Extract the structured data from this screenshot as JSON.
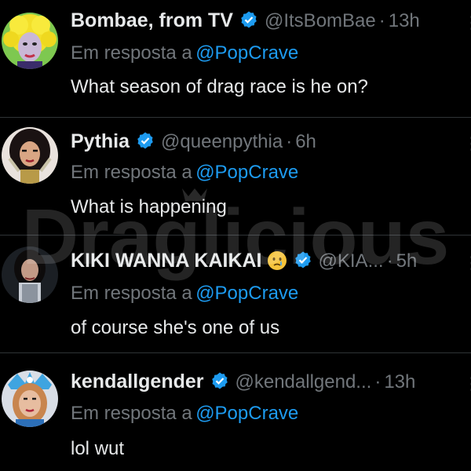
{
  "reply_prefix": "Em resposta a",
  "colors": {
    "background": "#000000",
    "primary_text": "#e7e9ea",
    "secondary_text": "#71767b",
    "link": "#1d9bf0",
    "verified": "#1d9bf0",
    "divider": "#2f3336"
  },
  "watermark": {
    "text": "Draglicious"
  },
  "tweets": [
    {
      "name": "Bombae, from TV",
      "handle": "@ItsBomBae",
      "time": "13h",
      "reply_to": "@PopCrave",
      "text": "What season of drag race is he on?",
      "avatar_icon": "avatar-yellow-hair-icon"
    },
    {
      "name": "Pythia",
      "handle": "@queenpythia",
      "time": "6h",
      "reply_to": "@PopCrave",
      "text": "What is happening",
      "avatar_icon": "avatar-drag-queen-icon"
    },
    {
      "name": "KIKI WANNA KAIKAI",
      "name_emoji": "crying-face-emoji",
      "handle": "@KIA...",
      "time": "5h",
      "reply_to": "@PopCrave",
      "text": "of course she's one of us",
      "avatar_icon": "avatar-dark-hair-icon"
    },
    {
      "name": "kendallgender",
      "handle": "@kendallgend...",
      "time": "13h",
      "reply_to": "@PopCrave",
      "text": "lol wut",
      "avatar_icon": "avatar-blue-crown-icon"
    }
  ]
}
